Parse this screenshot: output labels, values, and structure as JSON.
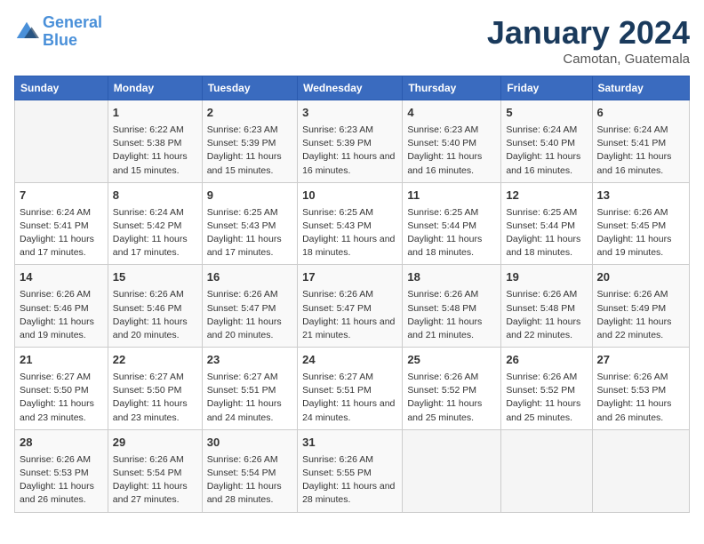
{
  "logo": {
    "line1": "General",
    "line2": "Blue"
  },
  "title": "January 2024",
  "subtitle": "Camotan, Guatemala",
  "headers": [
    "Sunday",
    "Monday",
    "Tuesday",
    "Wednesday",
    "Thursday",
    "Friday",
    "Saturday"
  ],
  "weeks": [
    [
      {
        "day": "",
        "sunrise": "",
        "sunset": "",
        "daylight": ""
      },
      {
        "day": "1",
        "sunrise": "Sunrise: 6:22 AM",
        "sunset": "Sunset: 5:38 PM",
        "daylight": "Daylight: 11 hours and 15 minutes."
      },
      {
        "day": "2",
        "sunrise": "Sunrise: 6:23 AM",
        "sunset": "Sunset: 5:39 PM",
        "daylight": "Daylight: 11 hours and 15 minutes."
      },
      {
        "day": "3",
        "sunrise": "Sunrise: 6:23 AM",
        "sunset": "Sunset: 5:39 PM",
        "daylight": "Daylight: 11 hours and 16 minutes."
      },
      {
        "day": "4",
        "sunrise": "Sunrise: 6:23 AM",
        "sunset": "Sunset: 5:40 PM",
        "daylight": "Daylight: 11 hours and 16 minutes."
      },
      {
        "day": "5",
        "sunrise": "Sunrise: 6:24 AM",
        "sunset": "Sunset: 5:40 PM",
        "daylight": "Daylight: 11 hours and 16 minutes."
      },
      {
        "day": "6",
        "sunrise": "Sunrise: 6:24 AM",
        "sunset": "Sunset: 5:41 PM",
        "daylight": "Daylight: 11 hours and 16 minutes."
      }
    ],
    [
      {
        "day": "7",
        "sunrise": "Sunrise: 6:24 AM",
        "sunset": "Sunset: 5:41 PM",
        "daylight": "Daylight: 11 hours and 17 minutes."
      },
      {
        "day": "8",
        "sunrise": "Sunrise: 6:24 AM",
        "sunset": "Sunset: 5:42 PM",
        "daylight": "Daylight: 11 hours and 17 minutes."
      },
      {
        "day": "9",
        "sunrise": "Sunrise: 6:25 AM",
        "sunset": "Sunset: 5:43 PM",
        "daylight": "Daylight: 11 hours and 17 minutes."
      },
      {
        "day": "10",
        "sunrise": "Sunrise: 6:25 AM",
        "sunset": "Sunset: 5:43 PM",
        "daylight": "Daylight: 11 hours and 18 minutes."
      },
      {
        "day": "11",
        "sunrise": "Sunrise: 6:25 AM",
        "sunset": "Sunset: 5:44 PM",
        "daylight": "Daylight: 11 hours and 18 minutes."
      },
      {
        "day": "12",
        "sunrise": "Sunrise: 6:25 AM",
        "sunset": "Sunset: 5:44 PM",
        "daylight": "Daylight: 11 hours and 18 minutes."
      },
      {
        "day": "13",
        "sunrise": "Sunrise: 6:26 AM",
        "sunset": "Sunset: 5:45 PM",
        "daylight": "Daylight: 11 hours and 19 minutes."
      }
    ],
    [
      {
        "day": "14",
        "sunrise": "Sunrise: 6:26 AM",
        "sunset": "Sunset: 5:46 PM",
        "daylight": "Daylight: 11 hours and 19 minutes."
      },
      {
        "day": "15",
        "sunrise": "Sunrise: 6:26 AM",
        "sunset": "Sunset: 5:46 PM",
        "daylight": "Daylight: 11 hours and 20 minutes."
      },
      {
        "day": "16",
        "sunrise": "Sunrise: 6:26 AM",
        "sunset": "Sunset: 5:47 PM",
        "daylight": "Daylight: 11 hours and 20 minutes."
      },
      {
        "day": "17",
        "sunrise": "Sunrise: 6:26 AM",
        "sunset": "Sunset: 5:47 PM",
        "daylight": "Daylight: 11 hours and 21 minutes."
      },
      {
        "day": "18",
        "sunrise": "Sunrise: 6:26 AM",
        "sunset": "Sunset: 5:48 PM",
        "daylight": "Daylight: 11 hours and 21 minutes."
      },
      {
        "day": "19",
        "sunrise": "Sunrise: 6:26 AM",
        "sunset": "Sunset: 5:48 PM",
        "daylight": "Daylight: 11 hours and 22 minutes."
      },
      {
        "day": "20",
        "sunrise": "Sunrise: 6:26 AM",
        "sunset": "Sunset: 5:49 PM",
        "daylight": "Daylight: 11 hours and 22 minutes."
      }
    ],
    [
      {
        "day": "21",
        "sunrise": "Sunrise: 6:27 AM",
        "sunset": "Sunset: 5:50 PM",
        "daylight": "Daylight: 11 hours and 23 minutes."
      },
      {
        "day": "22",
        "sunrise": "Sunrise: 6:27 AM",
        "sunset": "Sunset: 5:50 PM",
        "daylight": "Daylight: 11 hours and 23 minutes."
      },
      {
        "day": "23",
        "sunrise": "Sunrise: 6:27 AM",
        "sunset": "Sunset: 5:51 PM",
        "daylight": "Daylight: 11 hours and 24 minutes."
      },
      {
        "day": "24",
        "sunrise": "Sunrise: 6:27 AM",
        "sunset": "Sunset: 5:51 PM",
        "daylight": "Daylight: 11 hours and 24 minutes."
      },
      {
        "day": "25",
        "sunrise": "Sunrise: 6:26 AM",
        "sunset": "Sunset: 5:52 PM",
        "daylight": "Daylight: 11 hours and 25 minutes."
      },
      {
        "day": "26",
        "sunrise": "Sunrise: 6:26 AM",
        "sunset": "Sunset: 5:52 PM",
        "daylight": "Daylight: 11 hours and 25 minutes."
      },
      {
        "day": "27",
        "sunrise": "Sunrise: 6:26 AM",
        "sunset": "Sunset: 5:53 PM",
        "daylight": "Daylight: 11 hours and 26 minutes."
      }
    ],
    [
      {
        "day": "28",
        "sunrise": "Sunrise: 6:26 AM",
        "sunset": "Sunset: 5:53 PM",
        "daylight": "Daylight: 11 hours and 26 minutes."
      },
      {
        "day": "29",
        "sunrise": "Sunrise: 6:26 AM",
        "sunset": "Sunset: 5:54 PM",
        "daylight": "Daylight: 11 hours and 27 minutes."
      },
      {
        "day": "30",
        "sunrise": "Sunrise: 6:26 AM",
        "sunset": "Sunset: 5:54 PM",
        "daylight": "Daylight: 11 hours and 28 minutes."
      },
      {
        "day": "31",
        "sunrise": "Sunrise: 6:26 AM",
        "sunset": "Sunset: 5:55 PM",
        "daylight": "Daylight: 11 hours and 28 minutes."
      },
      {
        "day": "",
        "sunrise": "",
        "sunset": "",
        "daylight": ""
      },
      {
        "day": "",
        "sunrise": "",
        "sunset": "",
        "daylight": ""
      },
      {
        "day": "",
        "sunrise": "",
        "sunset": "",
        "daylight": ""
      }
    ]
  ]
}
